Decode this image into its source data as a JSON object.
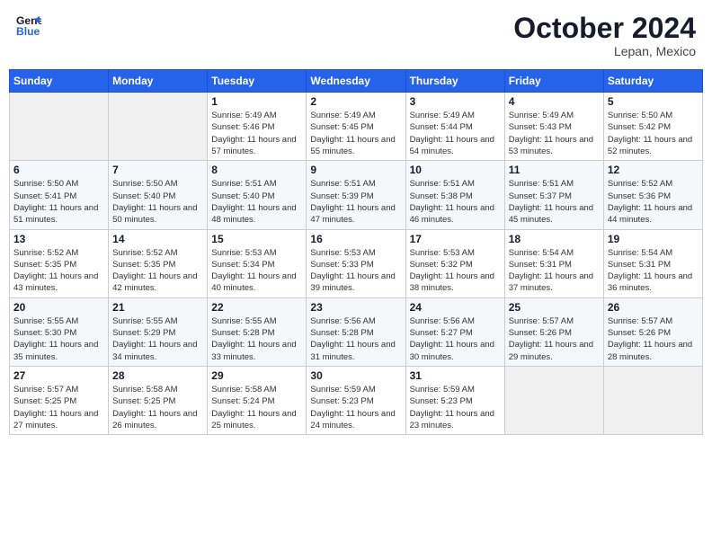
{
  "header": {
    "logo_line1": "General",
    "logo_line2": "Blue",
    "month": "October 2024",
    "location": "Lepan, Mexico"
  },
  "weekdays": [
    "Sunday",
    "Monday",
    "Tuesday",
    "Wednesday",
    "Thursday",
    "Friday",
    "Saturday"
  ],
  "weeks": [
    [
      {
        "day": "",
        "info": ""
      },
      {
        "day": "",
        "info": ""
      },
      {
        "day": "1",
        "info": "Sunrise: 5:49 AM\nSunset: 5:46 PM\nDaylight: 11 hours and 57 minutes."
      },
      {
        "day": "2",
        "info": "Sunrise: 5:49 AM\nSunset: 5:45 PM\nDaylight: 11 hours and 55 minutes."
      },
      {
        "day": "3",
        "info": "Sunrise: 5:49 AM\nSunset: 5:44 PM\nDaylight: 11 hours and 54 minutes."
      },
      {
        "day": "4",
        "info": "Sunrise: 5:49 AM\nSunset: 5:43 PM\nDaylight: 11 hours and 53 minutes."
      },
      {
        "day": "5",
        "info": "Sunrise: 5:50 AM\nSunset: 5:42 PM\nDaylight: 11 hours and 52 minutes."
      }
    ],
    [
      {
        "day": "6",
        "info": "Sunrise: 5:50 AM\nSunset: 5:41 PM\nDaylight: 11 hours and 51 minutes."
      },
      {
        "day": "7",
        "info": "Sunrise: 5:50 AM\nSunset: 5:40 PM\nDaylight: 11 hours and 50 minutes."
      },
      {
        "day": "8",
        "info": "Sunrise: 5:51 AM\nSunset: 5:40 PM\nDaylight: 11 hours and 48 minutes."
      },
      {
        "day": "9",
        "info": "Sunrise: 5:51 AM\nSunset: 5:39 PM\nDaylight: 11 hours and 47 minutes."
      },
      {
        "day": "10",
        "info": "Sunrise: 5:51 AM\nSunset: 5:38 PM\nDaylight: 11 hours and 46 minutes."
      },
      {
        "day": "11",
        "info": "Sunrise: 5:51 AM\nSunset: 5:37 PM\nDaylight: 11 hours and 45 minutes."
      },
      {
        "day": "12",
        "info": "Sunrise: 5:52 AM\nSunset: 5:36 PM\nDaylight: 11 hours and 44 minutes."
      }
    ],
    [
      {
        "day": "13",
        "info": "Sunrise: 5:52 AM\nSunset: 5:35 PM\nDaylight: 11 hours and 43 minutes."
      },
      {
        "day": "14",
        "info": "Sunrise: 5:52 AM\nSunset: 5:35 PM\nDaylight: 11 hours and 42 minutes."
      },
      {
        "day": "15",
        "info": "Sunrise: 5:53 AM\nSunset: 5:34 PM\nDaylight: 11 hours and 40 minutes."
      },
      {
        "day": "16",
        "info": "Sunrise: 5:53 AM\nSunset: 5:33 PM\nDaylight: 11 hours and 39 minutes."
      },
      {
        "day": "17",
        "info": "Sunrise: 5:53 AM\nSunset: 5:32 PM\nDaylight: 11 hours and 38 minutes."
      },
      {
        "day": "18",
        "info": "Sunrise: 5:54 AM\nSunset: 5:31 PM\nDaylight: 11 hours and 37 minutes."
      },
      {
        "day": "19",
        "info": "Sunrise: 5:54 AM\nSunset: 5:31 PM\nDaylight: 11 hours and 36 minutes."
      }
    ],
    [
      {
        "day": "20",
        "info": "Sunrise: 5:55 AM\nSunset: 5:30 PM\nDaylight: 11 hours and 35 minutes."
      },
      {
        "day": "21",
        "info": "Sunrise: 5:55 AM\nSunset: 5:29 PM\nDaylight: 11 hours and 34 minutes."
      },
      {
        "day": "22",
        "info": "Sunrise: 5:55 AM\nSunset: 5:28 PM\nDaylight: 11 hours and 33 minutes."
      },
      {
        "day": "23",
        "info": "Sunrise: 5:56 AM\nSunset: 5:28 PM\nDaylight: 11 hours and 31 minutes."
      },
      {
        "day": "24",
        "info": "Sunrise: 5:56 AM\nSunset: 5:27 PM\nDaylight: 11 hours and 30 minutes."
      },
      {
        "day": "25",
        "info": "Sunrise: 5:57 AM\nSunset: 5:26 PM\nDaylight: 11 hours and 29 minutes."
      },
      {
        "day": "26",
        "info": "Sunrise: 5:57 AM\nSunset: 5:26 PM\nDaylight: 11 hours and 28 minutes."
      }
    ],
    [
      {
        "day": "27",
        "info": "Sunrise: 5:57 AM\nSunset: 5:25 PM\nDaylight: 11 hours and 27 minutes."
      },
      {
        "day": "28",
        "info": "Sunrise: 5:58 AM\nSunset: 5:25 PM\nDaylight: 11 hours and 26 minutes."
      },
      {
        "day": "29",
        "info": "Sunrise: 5:58 AM\nSunset: 5:24 PM\nDaylight: 11 hours and 25 minutes."
      },
      {
        "day": "30",
        "info": "Sunrise: 5:59 AM\nSunset: 5:23 PM\nDaylight: 11 hours and 24 minutes."
      },
      {
        "day": "31",
        "info": "Sunrise: 5:59 AM\nSunset: 5:23 PM\nDaylight: 11 hours and 23 minutes."
      },
      {
        "day": "",
        "info": ""
      },
      {
        "day": "",
        "info": ""
      }
    ]
  ]
}
